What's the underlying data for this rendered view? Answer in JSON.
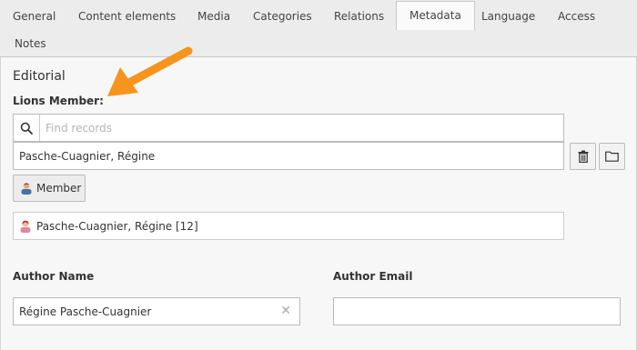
{
  "tabs": [
    {
      "label": "General"
    },
    {
      "label": "Content elements"
    },
    {
      "label": "Media"
    },
    {
      "label": "Categories"
    },
    {
      "label": "Relations"
    },
    {
      "label": "Metadata",
      "active": true
    },
    {
      "label": "Language"
    },
    {
      "label": "Access"
    },
    {
      "label": "Notes"
    }
  ],
  "section": {
    "title": "Editorial"
  },
  "lions_member": {
    "label": "Lions Member:",
    "search_placeholder": "Find records",
    "selected_value": "Pasche-Cuagnier, Régine",
    "member_button_label": "Member",
    "record_label": "Pasche-Cuagnier, Régine [12]"
  },
  "author_name": {
    "label": "Author Name",
    "value": "Régine Pasche-Cuagnier"
  },
  "author_email": {
    "label": "Author Email",
    "value": ""
  },
  "icons": {
    "search": "search-icon",
    "delete": "trash-icon",
    "browse": "folder-icon",
    "member": "user-icon",
    "record": "user-female-icon",
    "clear": "clear-icon",
    "annotation": "orange-arrow"
  },
  "colors": {
    "annotation_arrow": "#f7941d",
    "background": "#f7f7f7",
    "tabbar": "#ececec"
  }
}
